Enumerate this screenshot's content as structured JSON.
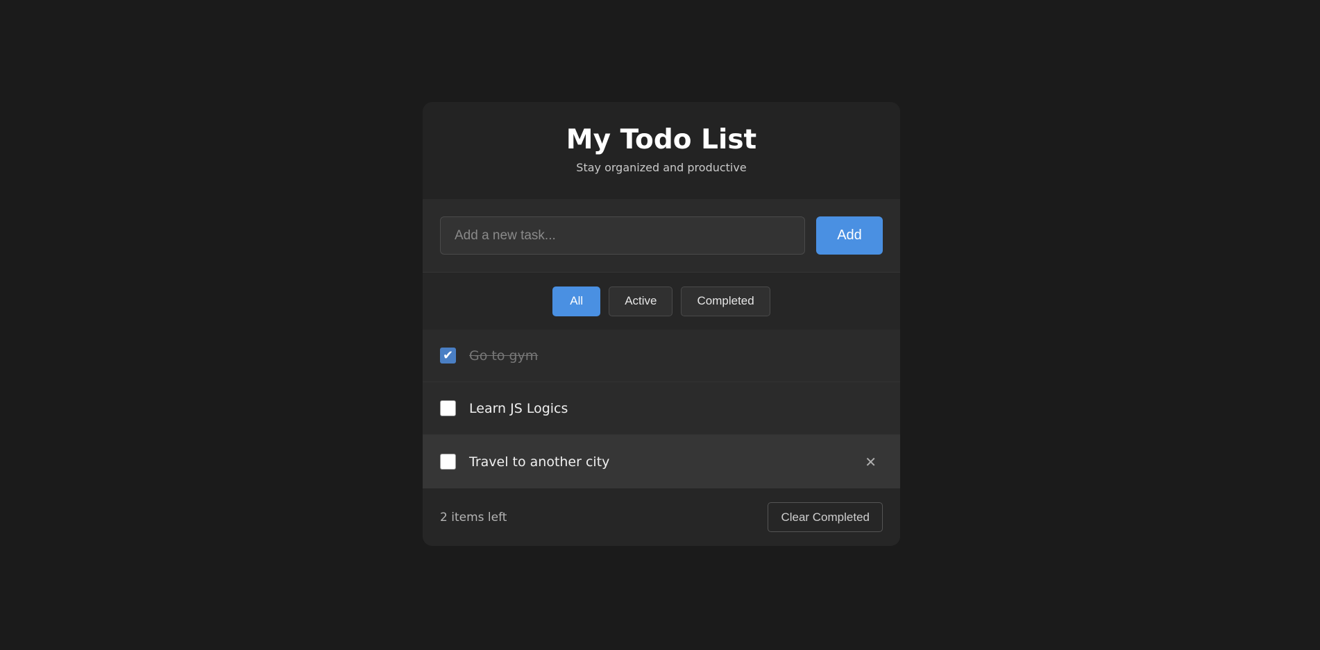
{
  "app": {
    "title": "My Todo List",
    "subtitle": "Stay organized and productive"
  },
  "input": {
    "placeholder": "Add a new task...",
    "value": "",
    "add_label": "Add"
  },
  "filters": [
    {
      "label": "All",
      "active": true
    },
    {
      "label": "Active",
      "active": false
    },
    {
      "label": "Completed",
      "active": false
    }
  ],
  "todos": [
    {
      "text": "Go to gym",
      "completed": true
    },
    {
      "text": "Learn JS Logics",
      "completed": false
    },
    {
      "text": "Travel to another city",
      "completed": false,
      "delete_icon": "close-icon",
      "delete_glyph": "✕"
    }
  ],
  "footer": {
    "items_left": "2 items left",
    "clear_label": "Clear Completed"
  },
  "colors": {
    "accent": "#4a90e2",
    "background": "#1b1b1b",
    "card": "#262626"
  },
  "icons": {
    "checkmark": "✔"
  }
}
